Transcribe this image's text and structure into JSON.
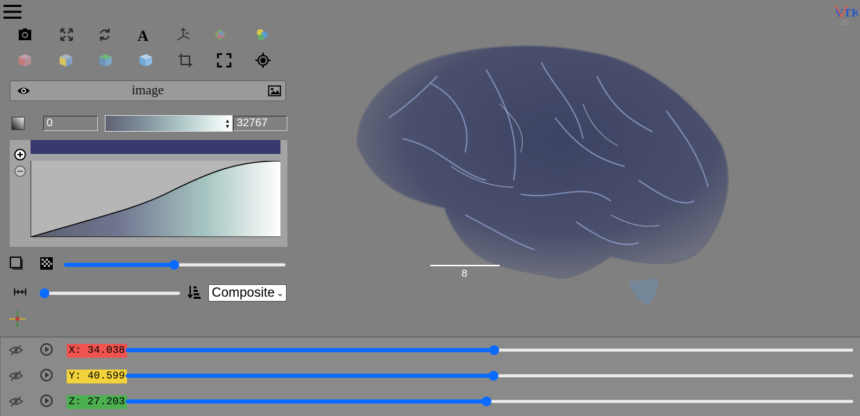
{
  "toolbar": {
    "row1": [
      "camera-icon",
      "expand-icon",
      "reset-rotation-icon",
      "text-annotation-icon",
      "axes-icon",
      "orientation-widget-icon",
      "color-channels-icon"
    ],
    "row2": [
      "view-x-icon",
      "view-y-icon",
      "view-z-icon",
      "view-3d-icon",
      "crop-icon",
      "fullscreen-icon",
      "reset-camera-icon"
    ]
  },
  "image_panel": {
    "name": "image"
  },
  "colormap": {
    "min_value": "0",
    "max_value": "32767",
    "preset_colors": [
      "#5f6173",
      "#aec8c6",
      "#ffffff"
    ]
  },
  "transfer_function": {
    "bar_color": "#383a6e"
  },
  "opacity_slider": {
    "value": 0.5
  },
  "sample_distance_slider": {
    "value": 0.0
  },
  "blend_mode": {
    "selected": "Composite"
  },
  "scale_bar": {
    "label": "8"
  },
  "slices": [
    {
      "label": "X: 34.038",
      "color": "#ef5350",
      "value": 0.5
    },
    {
      "label": "Y: 40.599",
      "color": "#f3d33b",
      "value": 0.5
    },
    {
      "label": "Z: 27.203",
      "color": "#4caf50",
      "value": 0.5
    }
  ],
  "logo": {
    "text": "VTK JS"
  }
}
